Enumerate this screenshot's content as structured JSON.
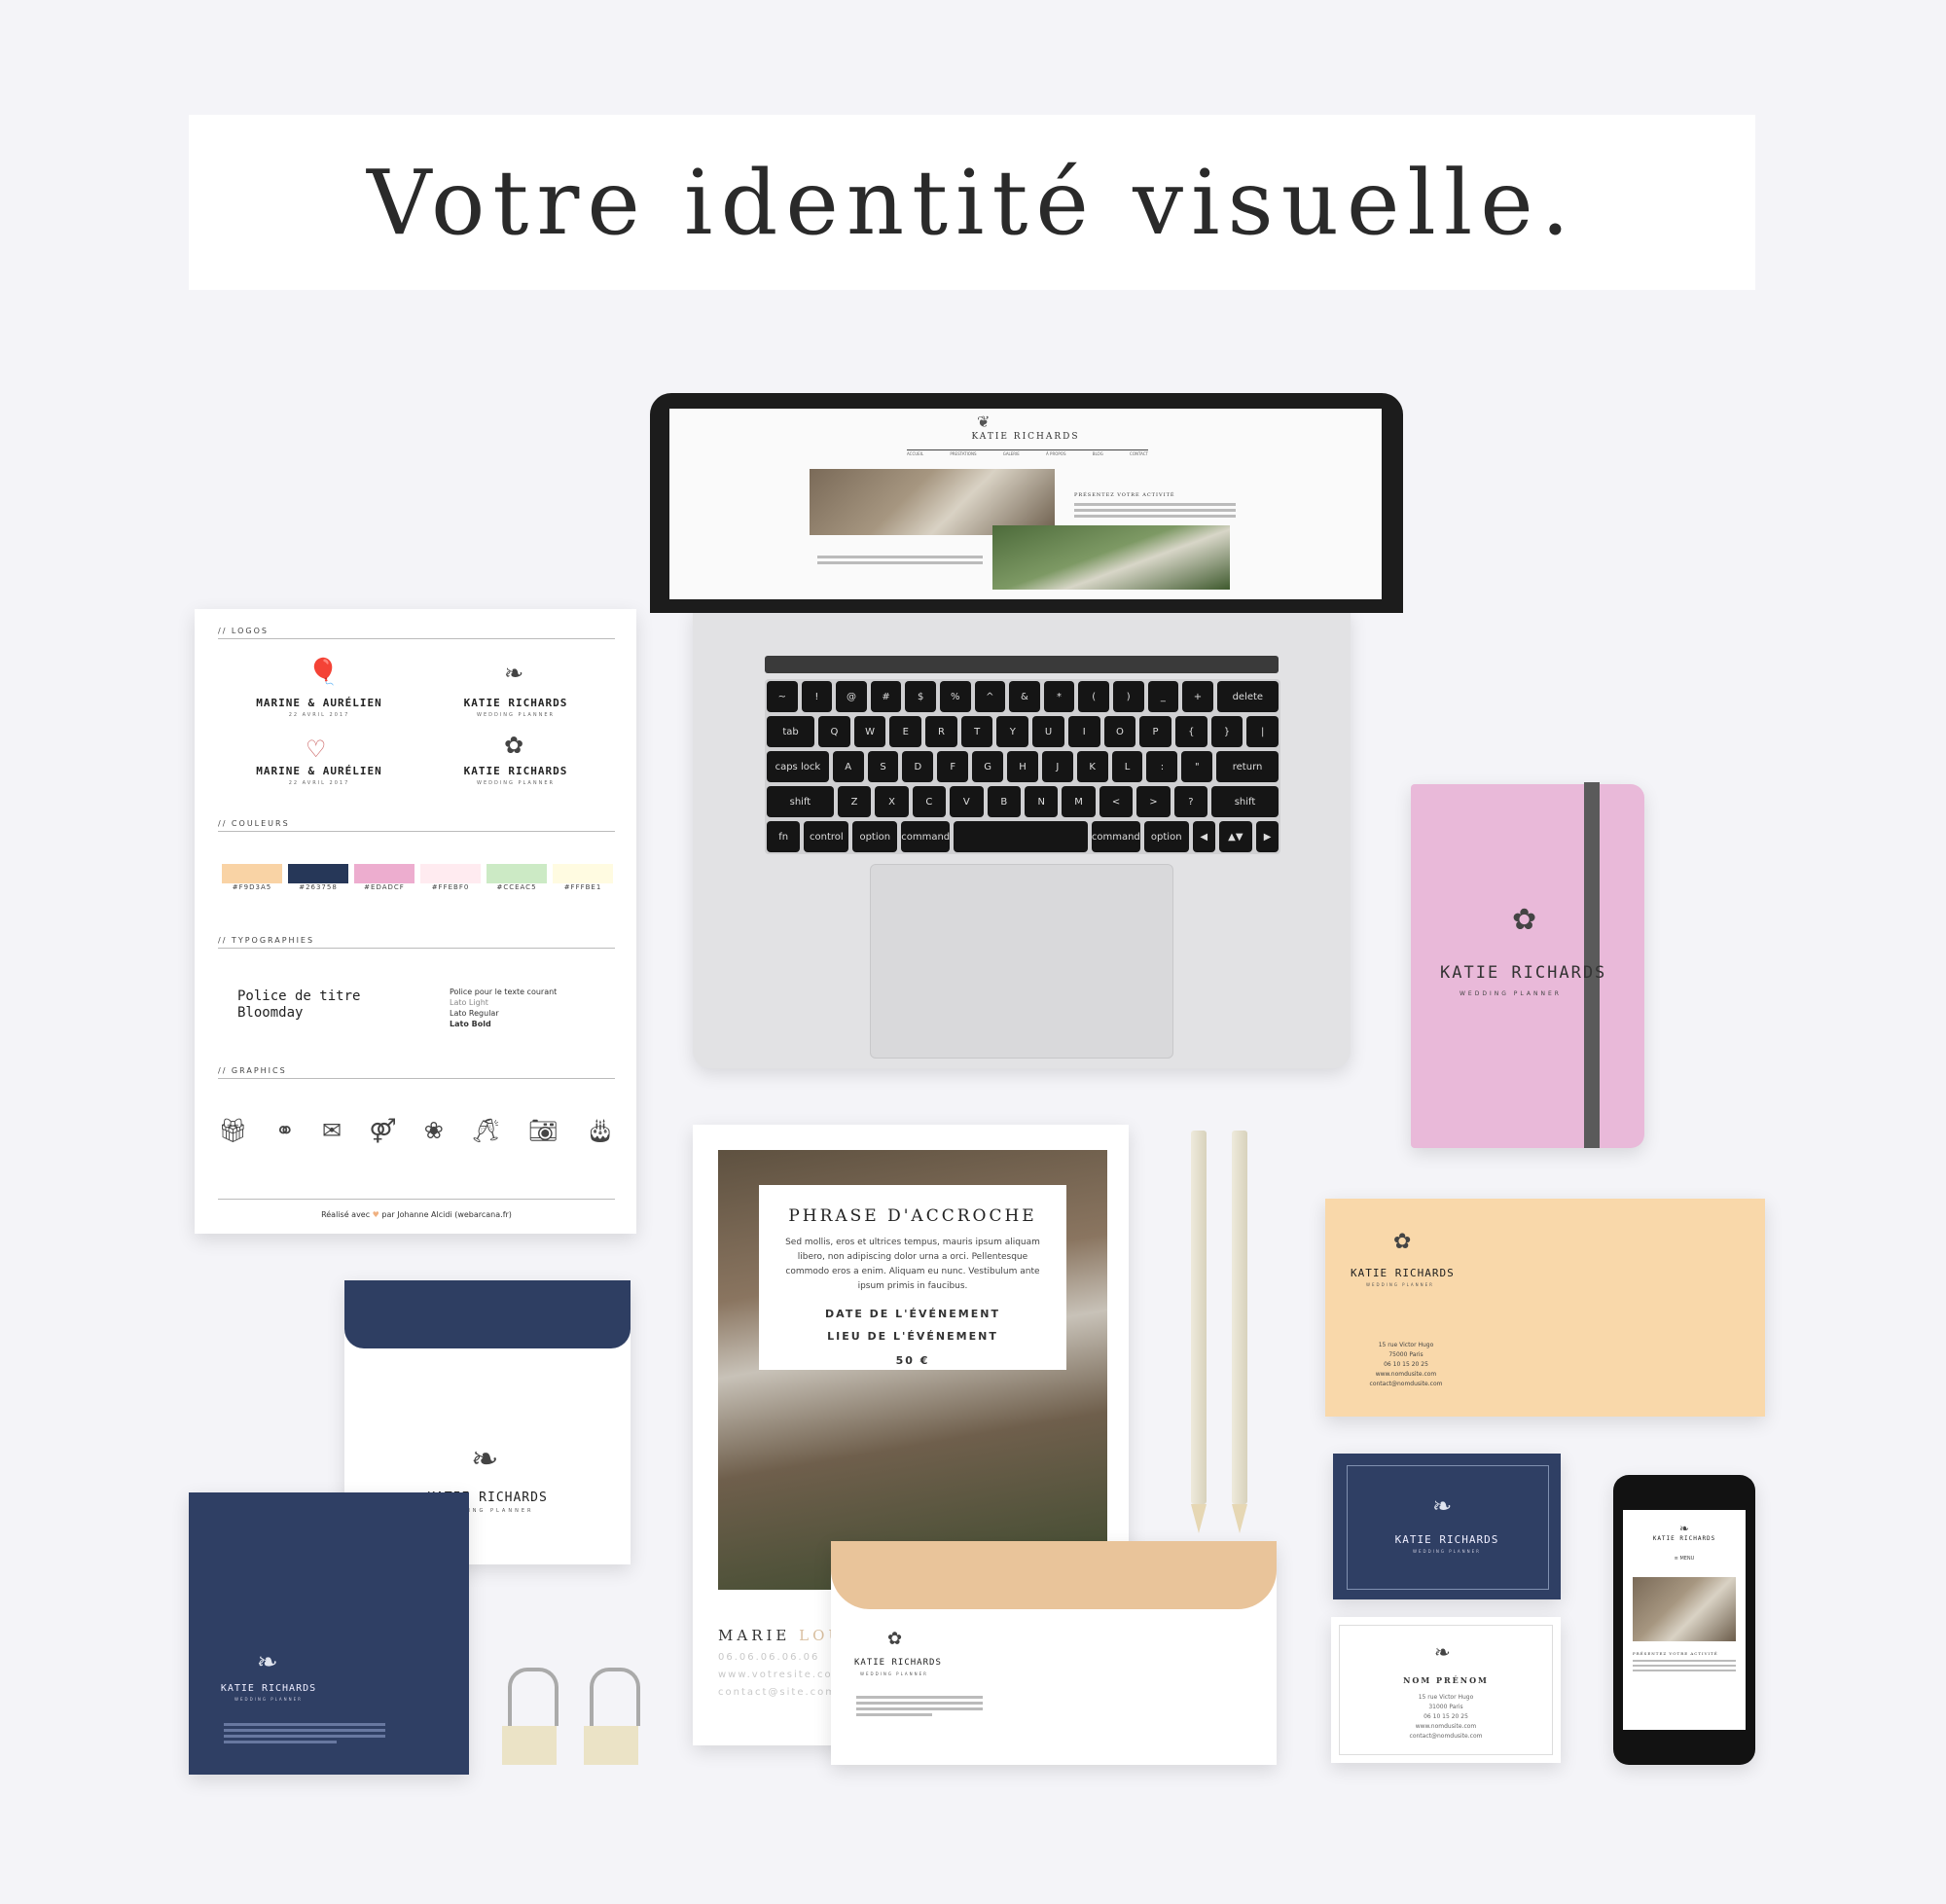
{
  "title": "Votre identité visuelle.",
  "laptop": {
    "site_logo": "KATIE RICHARDS",
    "nav_items": [
      "ACCUEIL",
      "PRESTATIONS",
      "GALERIE",
      "À PROPOS",
      "BLOG",
      "CONTACT"
    ],
    "section_title": "PRÉSENTEZ VOTRE ACTIVITÉ",
    "keyboard_rows": [
      [
        "~",
        "!",
        "@",
        "#",
        "$",
        "%",
        "^",
        "&",
        "*",
        "(",
        ")",
        "_",
        "+",
        "delete"
      ],
      [
        "tab",
        "Q",
        "W",
        "E",
        "R",
        "T",
        "Y",
        "U",
        "I",
        "O",
        "P",
        "{",
        "}",
        "|"
      ],
      [
        "caps lock",
        "A",
        "S",
        "D",
        "F",
        "G",
        "H",
        "J",
        "K",
        "L",
        ":",
        "\"",
        "return"
      ],
      [
        "shift",
        "Z",
        "X",
        "C",
        "V",
        "B",
        "N",
        "M",
        "<",
        ">",
        "?",
        "shift"
      ],
      [
        "fn",
        "control",
        "option",
        "command",
        "",
        "command",
        "option",
        "◀",
        "▲▼",
        "▶"
      ]
    ]
  },
  "brand_sheet": {
    "section_logos": "// LOGOS",
    "logos": [
      {
        "name": "MARINE & AURÉLIEN",
        "sub": "22 AVRIL 2017",
        "icon": "balloons-icon"
      },
      {
        "name": "KATIE RICHARDS",
        "sub": "WEDDING PLANNER",
        "icon": "branch-icon"
      },
      {
        "name": "MARINE & AURÉLIEN",
        "sub": "22 AVRIL 2017",
        "icon": "heart-arrow-icon"
      },
      {
        "name": "KATIE RICHARDS",
        "sub": "WEDDING PLANNER",
        "icon": "bouquet-icon"
      }
    ],
    "section_colors": "// COULEURS",
    "colors": [
      {
        "hex": "#F9D3A5",
        "label": "#F9D3A5"
      },
      {
        "hex": "#263758",
        "label": "#263758"
      },
      {
        "hex": "#EDADCF",
        "label": "#EDADCF"
      },
      {
        "hex": "#FFEBF0",
        "label": "#FFEBF0"
      },
      {
        "hex": "#CCEAC5",
        "label": "#CCEAC5"
      },
      {
        "hex": "#FFFBE1",
        "label": "#FFFBE1"
      }
    ],
    "section_typo": "// TYPOGRAPHIES",
    "typo_title_line1": "Police de titre",
    "typo_title_line2": "Bloomday",
    "typo_body_lines": [
      "Police pour le texte courant",
      "Lato Light",
      "Lato Regular",
      "Lato Bold"
    ],
    "section_graphics": "// GRAPHICS",
    "graphics": [
      "gift-icon",
      "rings-icon",
      "envelope-icon",
      "couple-icon",
      "wreath-icon",
      "champagne-icon",
      "camera-icon",
      "cake-icon"
    ],
    "footer_prefix": "Réalisé avec",
    "footer_suffix": "par Johanne Alcidi (webarcana.fr)"
  },
  "notebook": {
    "name": "KATIE RICHARDS",
    "sub": "WEDDING PLANNER",
    "color": "#EDADCF"
  },
  "flyer": {
    "title": "PHRASE D'ACCROCHE",
    "body": "Sed mollis, eros et ultrices tempus, mauris ipsum aliquam libero, non adipiscing dolor urna a orci. Pellentesque commodo eros a enim. Aliquam eu nunc. Vestibulum ante ipsum primis in faucibus.",
    "date": "DATE DE L'ÉVÉNEMENT",
    "place": "LIEU DE L'ÉVÉNEMENT",
    "price": "50 €",
    "name_main": "MARIE",
    "name_faded": "LOUI",
    "phone": "06.06.06.06.06",
    "web": "www.votresite.com",
    "email": "contact@site.com"
  },
  "envelopes": {
    "white_name": "KATIE RICHARDS",
    "white_sub": "WEDDING PLANNER",
    "navy_name": "KATIE RICHARDS",
    "navy_sub": "WEDDING PLANNER",
    "peach_name": "KATIE RICHARDS",
    "peach_sub": "WEDDING PLANNER"
  },
  "card_peach": {
    "name": "KATIE RICHARDS",
    "sub": "WEDDING PLANNER",
    "lines": [
      "15 rue Victor Hugo",
      "75000 Paris",
      "06 10 15 20 25",
      "www.nomdusite.com",
      "contact@nomdusite.com"
    ]
  },
  "card_navy": {
    "name": "KATIE RICHARDS",
    "sub": "WEDDING PLANNER"
  },
  "card_white": {
    "name": "NOM PRÉNOM",
    "lines": [
      "15 rue Victor Hugo",
      "31000 Paris",
      "06 10 15 20 25",
      "www.nomdusite.com",
      "contact@nomdusite.com"
    ]
  },
  "phone": {
    "site_logo": "KATIE RICHARDS",
    "menu": "≡ MENU",
    "section_title": "PRÉSENTEZ VOTRE ACTIVITÉ"
  }
}
